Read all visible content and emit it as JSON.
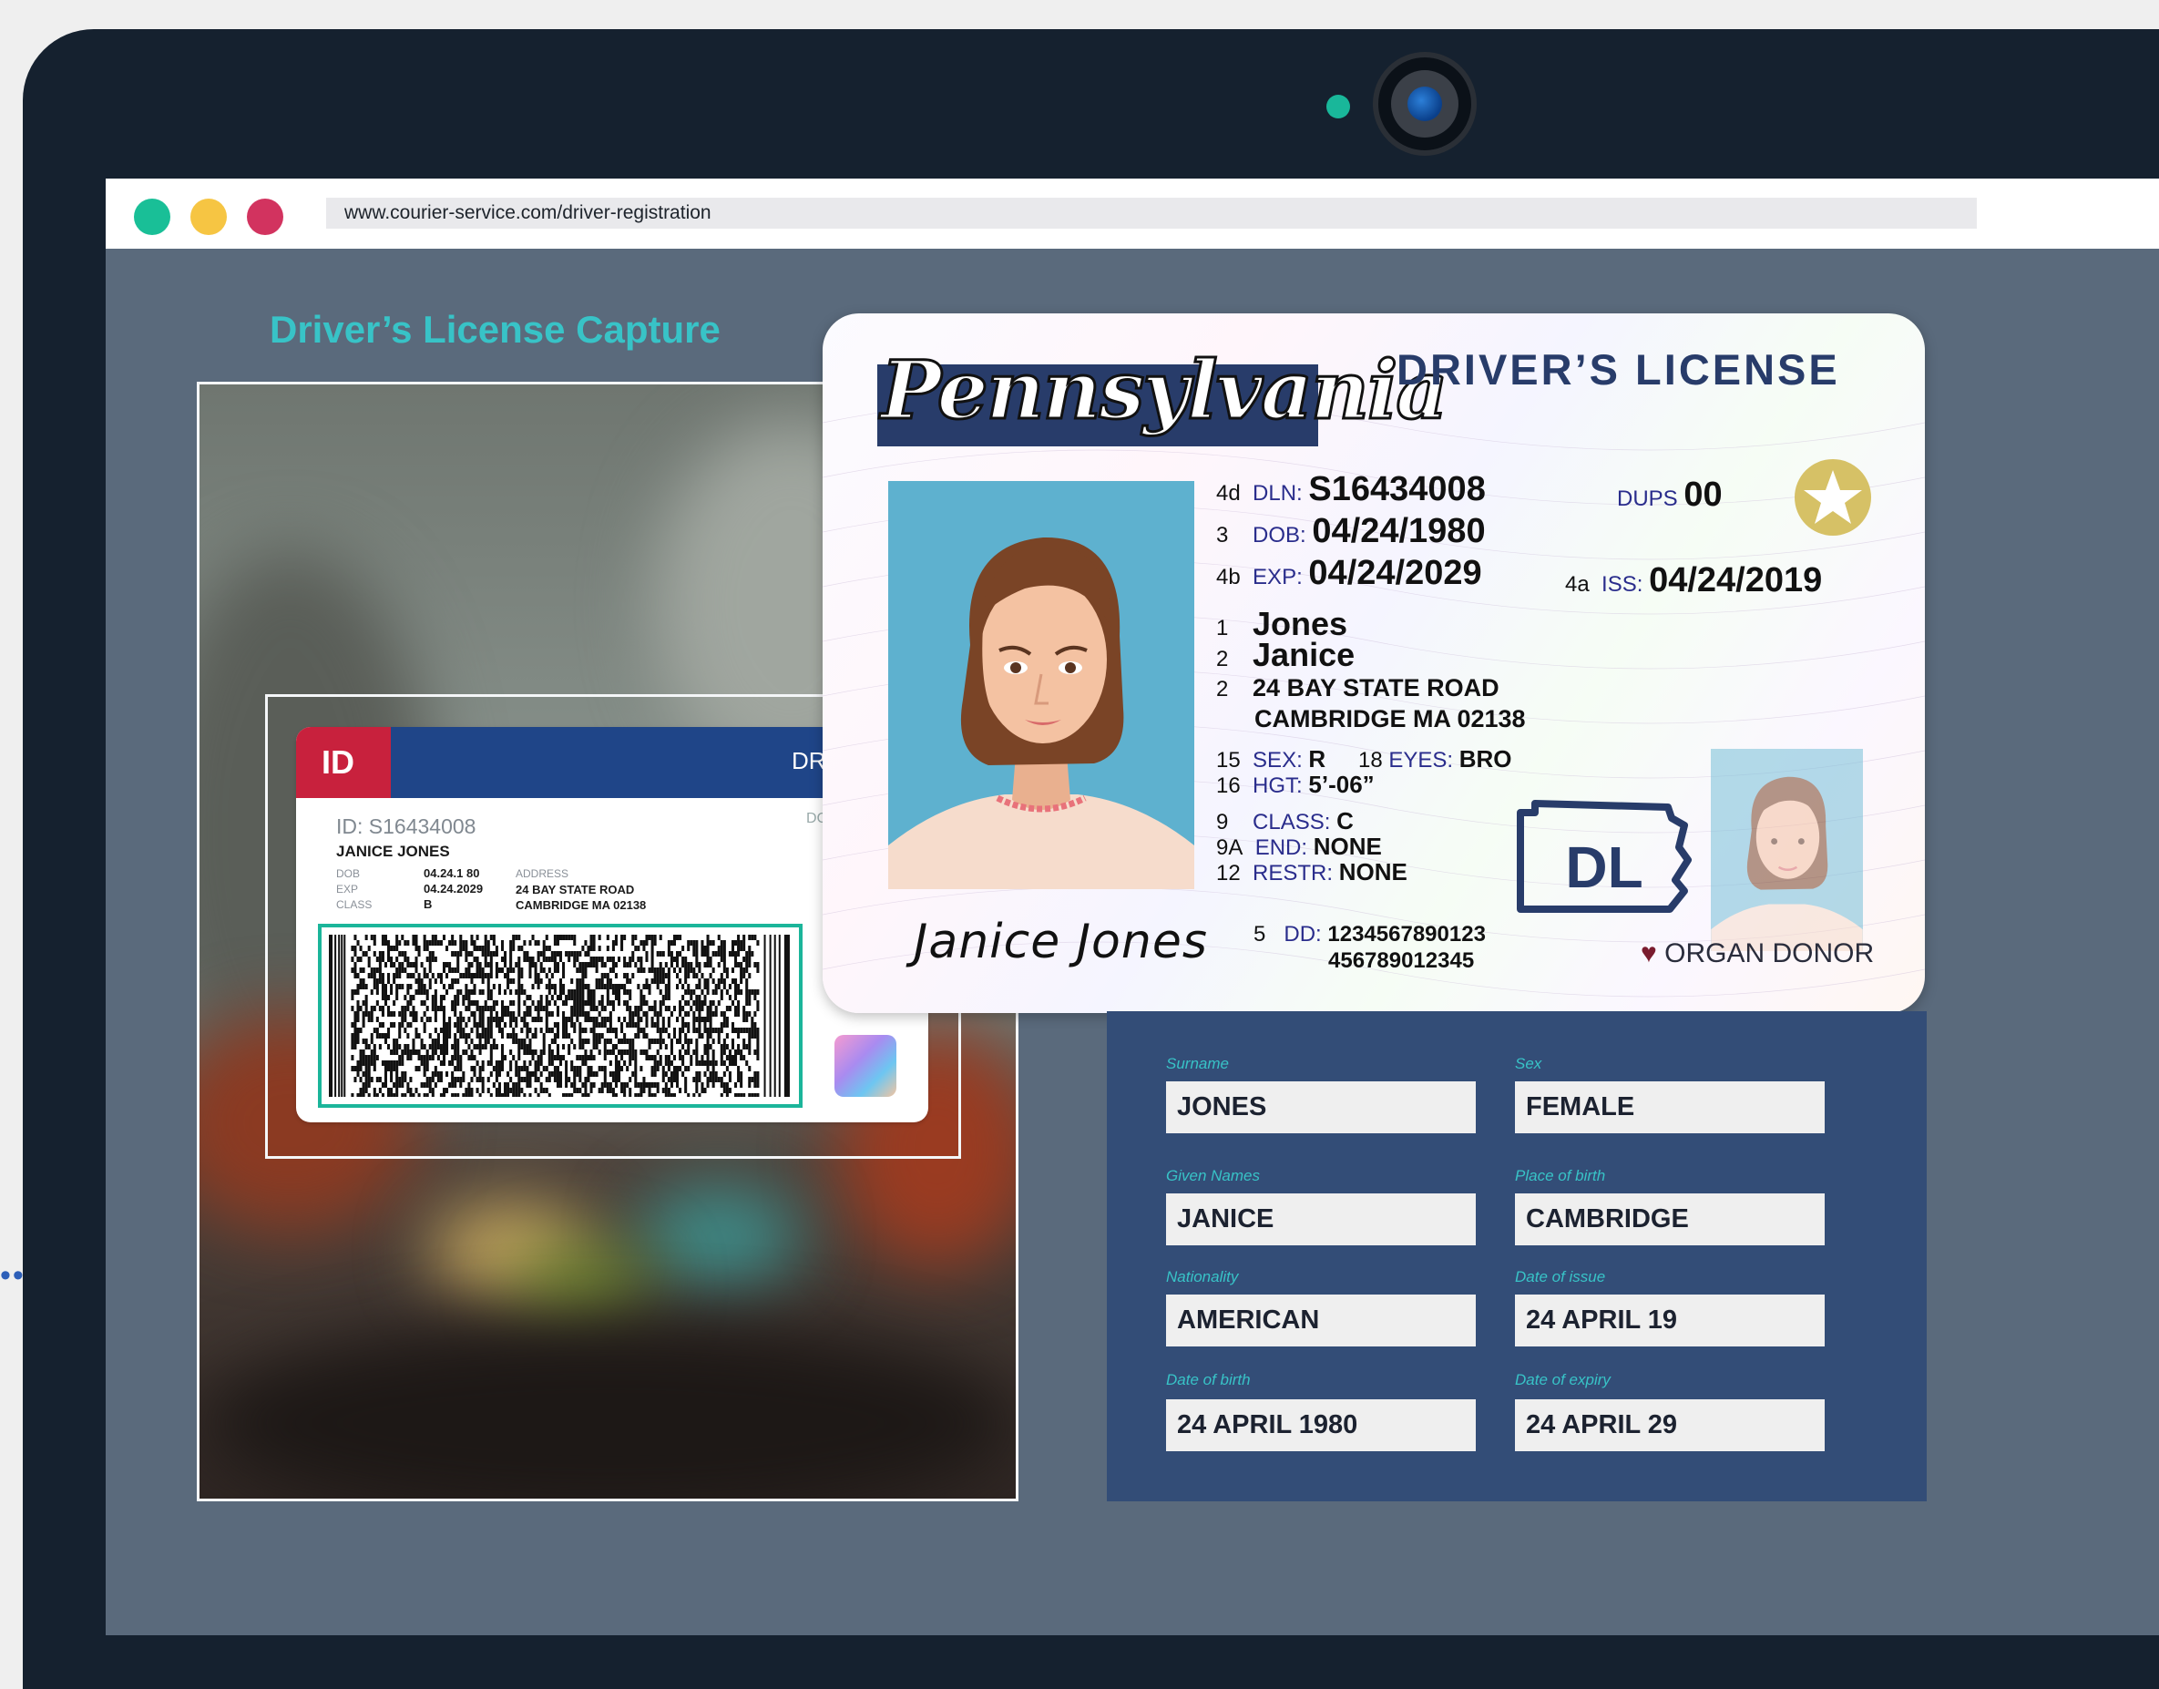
{
  "browser": {
    "url": "www.courier-service.com/driver-registration"
  },
  "capture": {
    "title": "Driver’s License Capture"
  },
  "small_card": {
    "badge": "ID",
    "title": "DRIVER LIC",
    "corner_text": "DC",
    "id_line": "ID: S16434008",
    "name": "JANICE JONES",
    "dob_label": "DOB",
    "dob_value": "04.24.1 80",
    "exp_label": "EXP",
    "exp_value": "04.24.2029",
    "class_label": "CLASS",
    "class_value": "B",
    "address_label": "ADDRESS",
    "address_line1": "24 BAY STATE ROAD",
    "address_line2": "CAMBRIDGE MA 02138"
  },
  "license": {
    "state": "Pennsylvania",
    "heading": "DRIVER’S LICENSE",
    "dln": {
      "num": "4d",
      "label": "DLN:",
      "value": "S16434008"
    },
    "dob": {
      "num": "3",
      "label": "DOB:",
      "value": "04/24/1980"
    },
    "exp": {
      "num": "4b",
      "label": "EXP:",
      "value": "04/24/2029"
    },
    "dups": {
      "label": "DUPS",
      "value": "00"
    },
    "iss": {
      "num": "4a",
      "label": "ISS:",
      "value": "04/24/2019"
    },
    "surname": {
      "num": "1",
      "value": "Jones"
    },
    "given": {
      "num": "2",
      "value": "Janice"
    },
    "address1": {
      "num": "2",
      "value": "24 BAY STATE ROAD"
    },
    "address2": "CAMBRIDGE MA 02138",
    "sex": {
      "num": "15",
      "label": "SEX:",
      "value": "R"
    },
    "eyes": {
      "num": "18",
      "label": "EYES:",
      "value": "BRO"
    },
    "hgt": {
      "num": "16",
      "label": "HGT:",
      "value": "5’-06”"
    },
    "class": {
      "num": "9",
      "label": "CLASS:",
      "value": "C"
    },
    "end": {
      "num": "9A",
      "label": "END:",
      "value": "NONE"
    },
    "restr": {
      "num": "12",
      "label": "RESTR:",
      "value": "NONE"
    },
    "dl_mark": "DL",
    "signature": "Janice Jones",
    "dd": {
      "num": "5",
      "label": "DD:",
      "value": "1234567890123",
      "value2": "456789012345"
    },
    "donor": "ORGAN DONOR"
  },
  "form": {
    "surname": {
      "label": "Surname",
      "value": "JONES"
    },
    "sex": {
      "label": "Sex",
      "value": "FEMALE"
    },
    "given": {
      "label": "Given  Names",
      "value": "JANICE"
    },
    "birthplace": {
      "label": "Place of birth",
      "value": "CAMBRIDGE"
    },
    "nationality": {
      "label": "Nationality",
      "value": "AMERICAN"
    },
    "issue": {
      "label": "Date of issue",
      "value": "24 APRIL 19"
    },
    "dob": {
      "label": "Date of birth",
      "value": "24 APRIL 1980"
    },
    "expiry": {
      "label": "Date of expiry",
      "value": "24 APRIL 29"
    }
  },
  "colors": {
    "accent": "#38c3c7",
    "panel": "#334d77",
    "viewport": "#5a6a7c",
    "bezel": "#15212f"
  }
}
